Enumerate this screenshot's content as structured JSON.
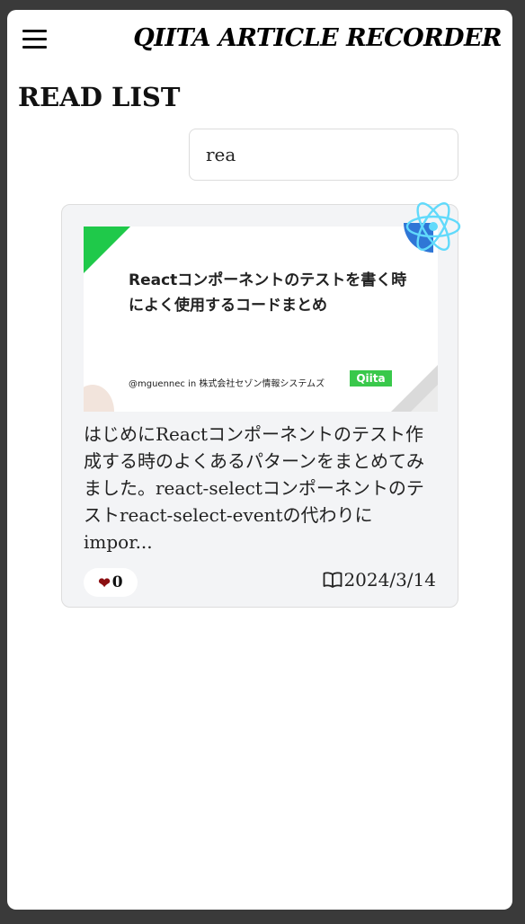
{
  "header": {
    "menu_icon": "hamburger-menu-icon",
    "app_title": "QIITA ARTICLE RECORDER"
  },
  "page": {
    "title": "READ LIST"
  },
  "search": {
    "value": "rea",
    "placeholder": ""
  },
  "articles": [
    {
      "thumbnail": {
        "title": "Reactコンポーネントのテストを書く時によく使用するコードまとめ",
        "author": "@mguennec in 株式会社セゾン情報システムズ",
        "logo_text": "Qiita"
      },
      "tag_icon": "react-logo-icon",
      "description": "はじめにReactコンポーネントのテスト作成する時のよくあるパターンをまとめてみました。react-selectコンポーネントのテストreact-select-eventの代わりにimpor...",
      "likes": "0",
      "like_icon": "heart-icon",
      "date_icon": "open-book-icon",
      "date": "2024/3/14"
    }
  ],
  "colors": {
    "background": "#3a3a3a",
    "card": "#f3f4f6",
    "heart": "#8b0f12",
    "qiita_green": "#39c84b",
    "react_blue": "#61dafb"
  }
}
